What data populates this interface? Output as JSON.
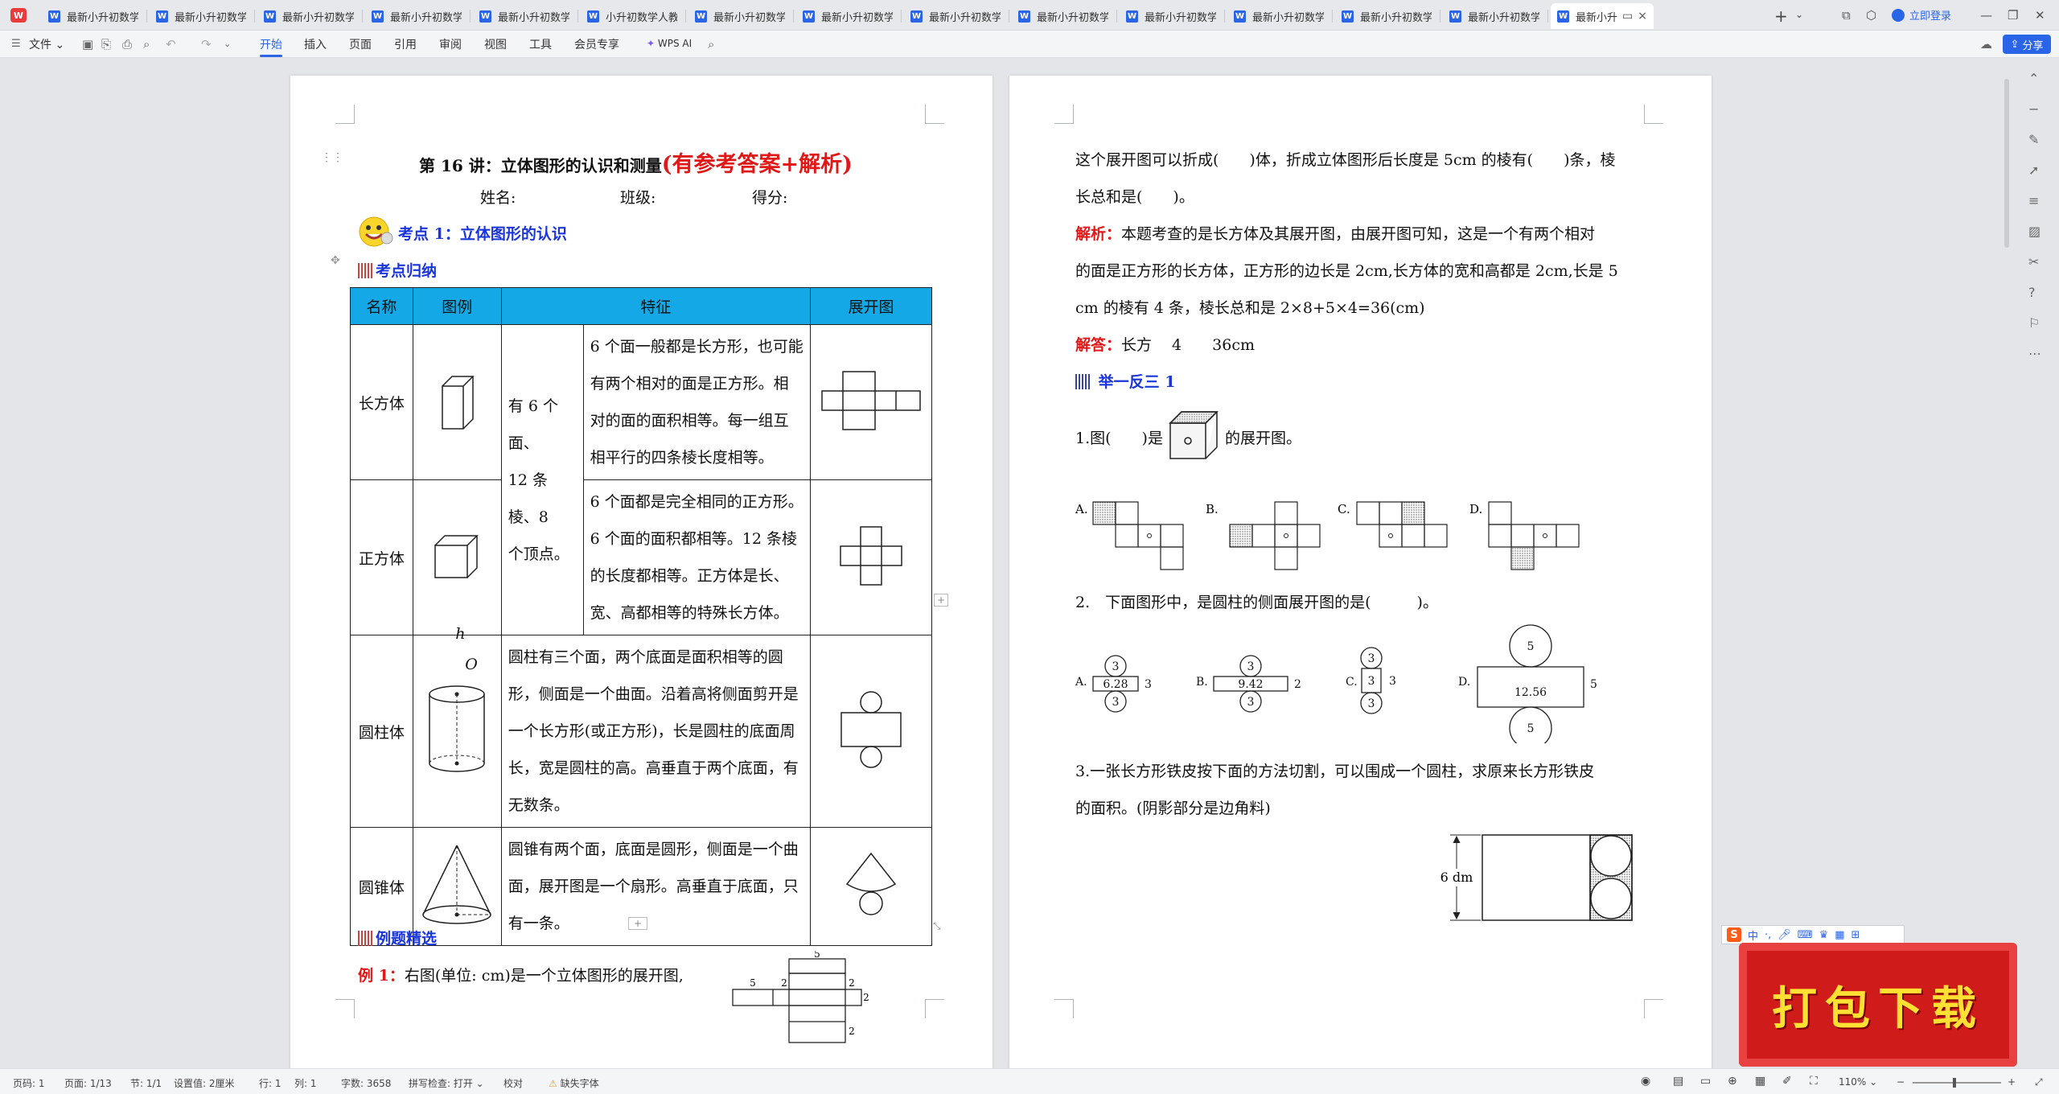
{
  "tabs": [
    {
      "label": "最新小升初数学"
    },
    {
      "label": "最新小升初数学"
    },
    {
      "label": "最新小升初数学"
    },
    {
      "label": "最新小升初数学"
    },
    {
      "label": "最新小升初数学"
    },
    {
      "label": "小升初数学人教"
    },
    {
      "label": "最新小升初数学"
    },
    {
      "label": "最新小升初数学"
    },
    {
      "label": "最新小升初数学"
    },
    {
      "label": "最新小升初数学"
    },
    {
      "label": "最新小升初数学"
    },
    {
      "label": "最新小升初数学"
    },
    {
      "label": "最新小升初数学"
    },
    {
      "label": "最新小升初数学"
    },
    {
      "label": "最新小升"
    }
  ],
  "tab_icon_letter": "W",
  "login_label": "立即登录",
  "menu": {
    "file": "文件",
    "items": [
      "开始",
      "插入",
      "页面",
      "引用",
      "审阅",
      "视图",
      "工具",
      "会员专享"
    ],
    "ai": "WPS AI",
    "share": "分享"
  },
  "page1": {
    "title": "第 16 讲：立体图形的认识和测量",
    "title_note": "(有参考答案+解析)",
    "name_label": "姓名:",
    "class_label": "班级:",
    "score_label": "得分:",
    "point1": "考点 1：立体图形的认识",
    "summary": "考点归纳",
    "table": {
      "headers": [
        "名称",
        "图例",
        "特征",
        "展开图"
      ],
      "shared_feature": [
        "有 6 个面、",
        "12 条棱、8",
        "个顶点。"
      ],
      "rows": [
        {
          "name": "长方体",
          "feature": "6 个面一般都是长方形，也可能有两个相对的面是正方形。相对的面的面积相等。每一组互相平行的四条棱长度相等。"
        },
        {
          "name": "正方体",
          "feature": "6 个面都是完全相同的正方形。6 个面的面积都相等。12 条棱的长度都相等。正方体是长、宽、高都相等的特殊长方体。"
        },
        {
          "name": "圆柱体",
          "feature": "圆柱有三个面，两个底面是面积相等的圆形，侧面是一个曲面。沿着高将侧面剪开是一个长方形(或正方形)，长是圆柱的底面周长，宽是圆柱的高。高垂直于两个底面，有无数条。"
        },
        {
          "name": "圆锥体",
          "feature": "圆锥有两个面，底面是圆形，侧面是一个曲面，展开图是一个扇形。高垂直于底面，只有一条。"
        }
      ],
      "fig_labels": {
        "h": "h",
        "o": "O"
      }
    },
    "examples_heading": "例题精选",
    "example1_label": "例 1：",
    "example1_text": "右图(单位: cm)是一个立体图形的展开图,",
    "net_dims": {
      "top": "5",
      "left": "5",
      "side_a": "2",
      "side_b": "2",
      "right": "2",
      "bottom": "2"
    }
  },
  "page2": {
    "line1": "这个展开图可以折成(　　)体，折成立体图形后长度是 5cm 的棱有(　　)条，棱",
    "line2": "长总和是(　　)。",
    "analysis_label": "解析：",
    "analysis_1": "本题考查的是长方体及其展开图，由展开图可知，这是一个有两个相对",
    "analysis_2": "的面是正方形的长方体，正方形的边长是 2cm,长方体的宽和高都是 2cm,长是 5",
    "analysis_3": "cm 的棱有 4 条，棱长总和是 2×8+5×4=36(cm)",
    "answer_label": "解答：",
    "answer_text": "长方　 4　　36cm",
    "practice_heading": "举一反三 1",
    "q1_a": "1.图(　　)是",
    "q1_b": "的展开图。",
    "q1_options": [
      "A.",
      "B.",
      "C.",
      "D."
    ],
    "q2": "2.　下面图形中，是圆柱的侧面展开图的是(　　　)。",
    "q2_options": [
      {
        "label": "A.",
        "inner": "6.28",
        "side": "3",
        "circle": "3"
      },
      {
        "label": "B.",
        "inner": "9.42",
        "side": "2",
        "circle": "3"
      },
      {
        "label": "C.",
        "inner": "3",
        "side": "3",
        "circle": "3"
      },
      {
        "label": "D.",
        "inner": "12.56",
        "side": "5",
        "circle": "5"
      }
    ],
    "q3_line1": "3.一张长方形铁皮按下面的方法切割，可以围成一个圆柱，求原来长方形铁皮",
    "q3_line2": "的面积。(阴影部分是边角料)",
    "q3_dim": "6 dm"
  },
  "ad_text": "打包下载",
  "ime_text": "中",
  "status": {
    "page": "页码: 1",
    "pages": "页面: 1/13",
    "section": "节: 1/1",
    "setting": "设置值: 2厘米",
    "row": "行: 1",
    "col": "列: 1",
    "words": "字数: 3658",
    "spell": "拼写检查: 打开",
    "proof": "校对",
    "missing_font": "缺失字体",
    "zoom": "110%"
  },
  "colors": {
    "accent": "#2a65e8",
    "table_header": "#14a8e6",
    "red": "#e01818",
    "heading_blue": "#1a35d8"
  }
}
